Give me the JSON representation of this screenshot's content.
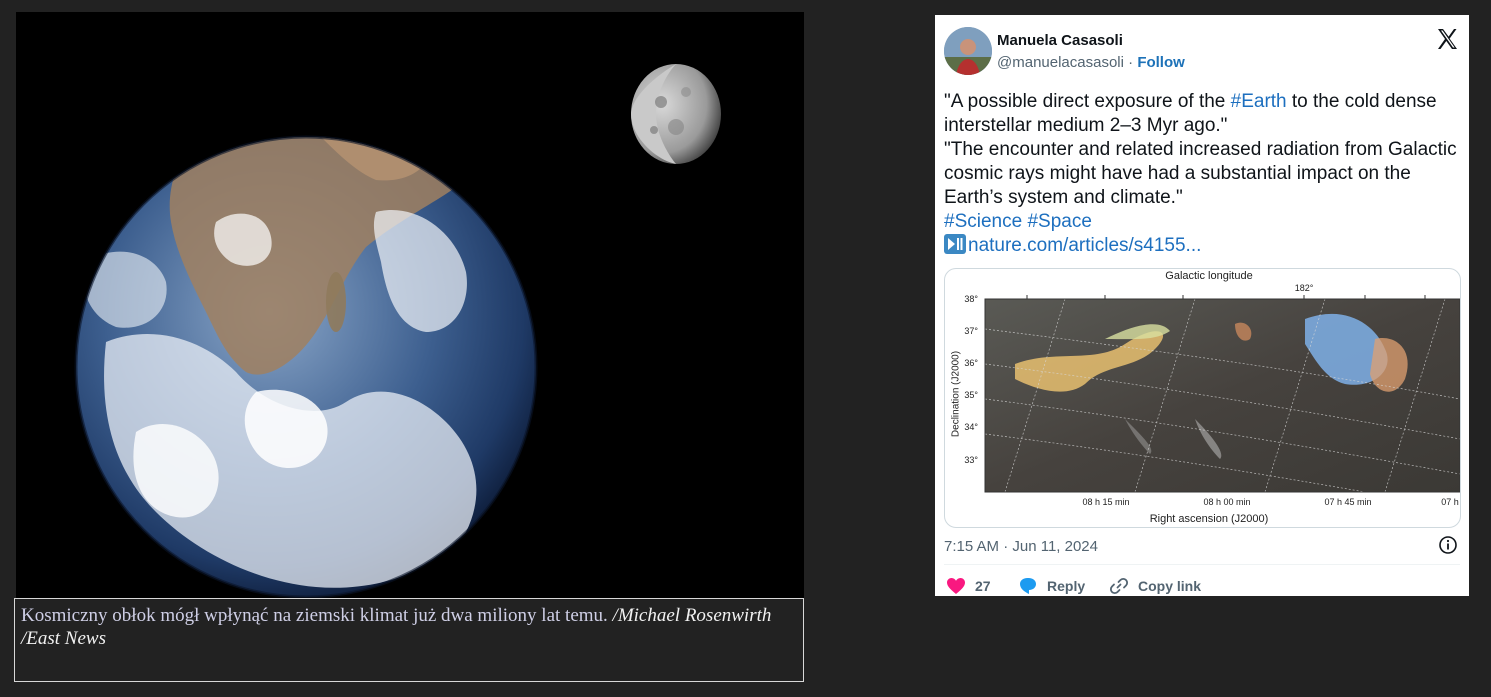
{
  "article": {
    "photo_alt_icon": "earth-moon-photo",
    "caption_text": "Kosmiczny obłok mógł wpłynąć na ziemski klimat już dwa miliony lat temu. ",
    "caption_credit": "/Michael Rosenwirth /East News"
  },
  "tweet": {
    "author_name": "Manuela Casasoli",
    "handle": "@manuelacasasoli",
    "separator": " · ",
    "follow_label": "Follow",
    "text_1a": "\"A possible direct exposure of the ",
    "hashtag_earth": "#Earth",
    "text_1b": " to the cold dense interstellar medium 2–3 Myr ago.\"",
    "text_2": "\"The encounter and related increased radiation from Galactic cosmic rays might have had a substantial impact on the Earth’s system and climate.\"",
    "hashtag_science": "#Science",
    "hashtag_space": "#Space",
    "link_text": "nature.com/articles/s4155...",
    "timestamp": "7:15 AM · Jun 11, 2024",
    "likes_count": "27",
    "reply_label": "Reply",
    "copy_link_label": "Copy link",
    "colors": {
      "link": "#1d6fbf",
      "like": "#f91880",
      "reply": "#1d9bf0"
    }
  },
  "media_figure": {
    "top_axis_title": "Galactic longitude",
    "top_tick": "182°",
    "y_axis_title": "Declination (J2000)",
    "y_ticks": [
      "38°",
      "37°",
      "36°",
      "35°",
      "34°",
      "33°"
    ],
    "x_ticks": [
      "08 h 15 min",
      "08 h 00 min",
      "07 h 45 min",
      "07 h"
    ],
    "x_axis_title": "Right ascension (J2000)"
  }
}
